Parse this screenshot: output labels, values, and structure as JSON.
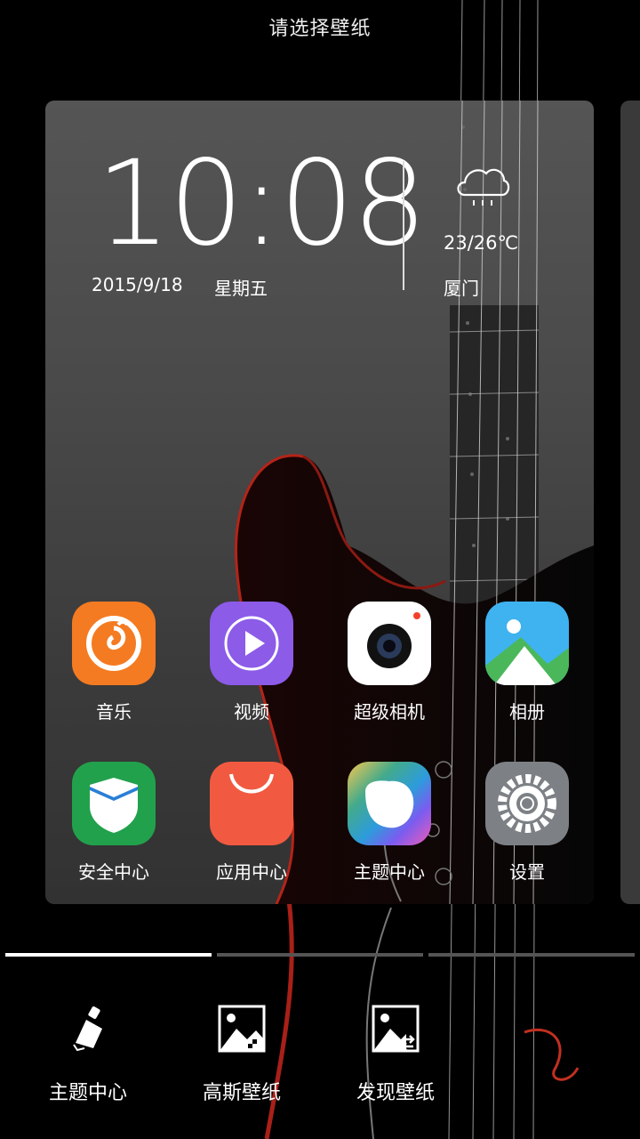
{
  "header": {
    "title": "请选择壁纸"
  },
  "preview": {
    "clock": {
      "time": "10:08",
      "date": "2015/9/18",
      "weekday": "星期五"
    },
    "weather": {
      "icon": "rain-cloud-icon",
      "temperature": "23/26℃",
      "city": "厦门"
    },
    "apps": [
      {
        "label": "音乐",
        "icon": "music-icon",
        "color": "#f47b22"
      },
      {
        "label": "视频",
        "icon": "video-play-icon",
        "color": "#8c5be8"
      },
      {
        "label": "超级相机",
        "icon": "camera-icon",
        "color": "#ffffff"
      },
      {
        "label": "相册",
        "icon": "gallery-icon",
        "color": "#3fb2f0"
      },
      {
        "label": "安全中心",
        "icon": "security-shield-icon",
        "color": "#22a14c"
      },
      {
        "label": "应用中心",
        "icon": "shopping-bag-icon",
        "color": "#f15a40"
      },
      {
        "label": "主题中心",
        "icon": "theme-palette-icon",
        "color": "#7a5cf0"
      },
      {
        "label": "设置",
        "icon": "gear-icon",
        "color": "#7d8186"
      }
    ]
  },
  "pager": {
    "count": 3,
    "active_index": 0
  },
  "bottom_tabs": [
    {
      "label": "主题中心",
      "icon": "brush-icon"
    },
    {
      "label": "高斯壁纸",
      "icon": "blur-wallpaper-icon"
    },
    {
      "label": "发现壁纸",
      "icon": "discover-wallpaper-icon"
    }
  ]
}
